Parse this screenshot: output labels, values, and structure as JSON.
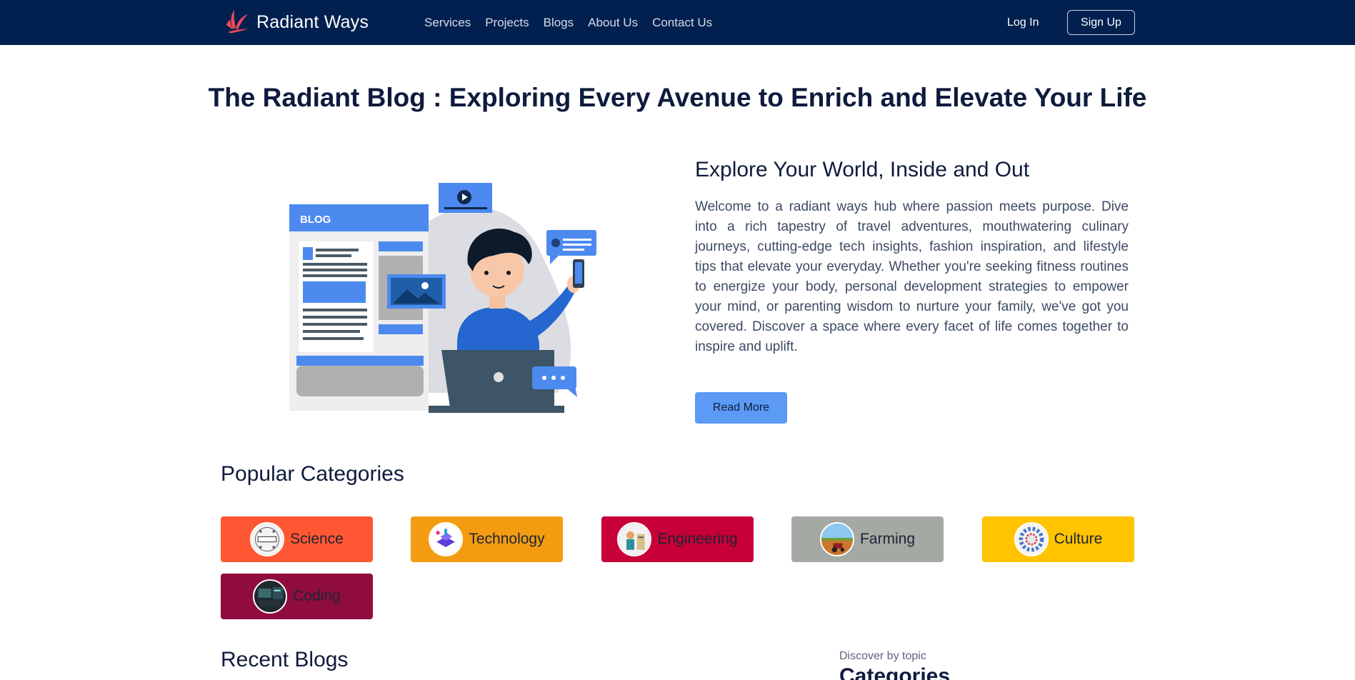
{
  "nav": {
    "brand": "Radiant Ways",
    "links": [
      "Services",
      "Projects",
      "Blogs",
      "About Us",
      "Contact Us"
    ],
    "login": "Log In",
    "signup": "Sign Up"
  },
  "hero": {
    "title_strong": "The Radiant Blog :",
    "title_rest": " Exploring Every Avenue to Enrich and Elevate Your Life"
  },
  "intro": {
    "illustration_label": "BLOG",
    "heading": "Explore Your World, Inside and Out",
    "text": "Welcome to a radiant ways hub where passion meets purpose. Dive into a rich tapestry of travel adventures, mouthwatering culinary journeys, cutting-edge tech insights, fashion inspiration, and lifestyle tips that elevate your everyday. Whether you're seeking fitness routines to energize your body, personal development strategies to empower your mind, or parenting wisdom to nurture your family, we've got you covered. Discover a space where every facet of life comes together to inspire and uplift.",
    "cta": "Read More"
  },
  "categories": {
    "title": "Popular Categories",
    "items": [
      {
        "label": "Science",
        "color": "#ff5733",
        "icon": "science-thumbnail"
      },
      {
        "label": "Technology",
        "color": "#f39c12",
        "icon": "technology-thumbnail"
      },
      {
        "label": "Engineering",
        "color": "#c70039",
        "icon": "engineering-thumbnail"
      },
      {
        "label": "Farming",
        "color": "#a5a9a3",
        "icon": "farming-thumbnail"
      },
      {
        "label": "Culture",
        "color": "#ffc300",
        "icon": "culture-thumbnail"
      },
      {
        "label": "Coding",
        "color": "#900c3f",
        "icon": "coding-thumbnail"
      }
    ]
  },
  "recent": {
    "title": "Recent Blogs"
  },
  "sidebar": {
    "eyebrow": "Discover by topic",
    "title": "Categories"
  },
  "colors": {
    "navbar": "#01204f",
    "accent_button": "#5b9bf5",
    "logo": "#ef4a5b"
  }
}
